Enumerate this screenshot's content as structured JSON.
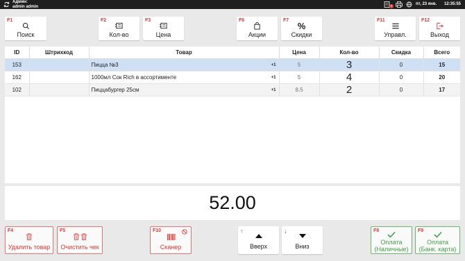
{
  "topbar": {
    "user_line1": "Админ:",
    "user_line2": "admin admin",
    "badge": "3",
    "date": "пт, 23 янв.",
    "time": "12:35:55"
  },
  "toolbar": {
    "search": {
      "key": "F1",
      "label": "Поиск"
    },
    "qty": {
      "key": "F2",
      "label": "Кол-во"
    },
    "price": {
      "key": "F3",
      "label": "Цена"
    },
    "promo": {
      "key": "F6",
      "label": "Акции"
    },
    "discounts": {
      "key": "F7",
      "label": "Скидки"
    },
    "manage": {
      "key": "F11",
      "label": "Управл."
    },
    "exit": {
      "key": "F12",
      "label": "Выход"
    }
  },
  "table": {
    "columns": [
      "ID",
      "Штрихкод",
      "Товар",
      "Цена",
      "Кол-во",
      "Скидка",
      "Всего"
    ],
    "rows": [
      {
        "id": "153",
        "barcode": "",
        "name": "Пицца №3",
        "plus": "+1",
        "price": "5",
        "qty": "3",
        "discount": "0",
        "total": "15"
      },
      {
        "id": "162",
        "barcode": "",
        "name": "1000мл Сок Rich в ассортименте",
        "plus": "+1",
        "price": "5",
        "qty": "4",
        "discount": "0",
        "total": "20"
      },
      {
        "id": "102",
        "barcode": "",
        "name": "Пиццабургер 25см",
        "plus": "+1",
        "price": "8.5",
        "qty": "2",
        "discount": "0",
        "total": "17"
      }
    ]
  },
  "total": "52.00",
  "bottom": {
    "delete": {
      "key": "F4",
      "label": "Удалить товар"
    },
    "clear": {
      "key": "F5",
      "label": "Очистить чек"
    },
    "scanner": {
      "key": "F10",
      "label": "Сканер"
    },
    "up": {
      "mark": "↑",
      "label": "Вверх"
    },
    "down": {
      "mark": "↓",
      "label": "Вниз"
    },
    "pay_cash": {
      "key": "F8",
      "label1": "Оплата",
      "label2": "(Наличные)"
    },
    "pay_card": {
      "key": "F9",
      "label1": "Оплата",
      "label2": "(Банк. карта)"
    }
  },
  "colors": {
    "fkey": "#e53935",
    "selected_row": "#cfe0f5",
    "green": "#43a047"
  }
}
